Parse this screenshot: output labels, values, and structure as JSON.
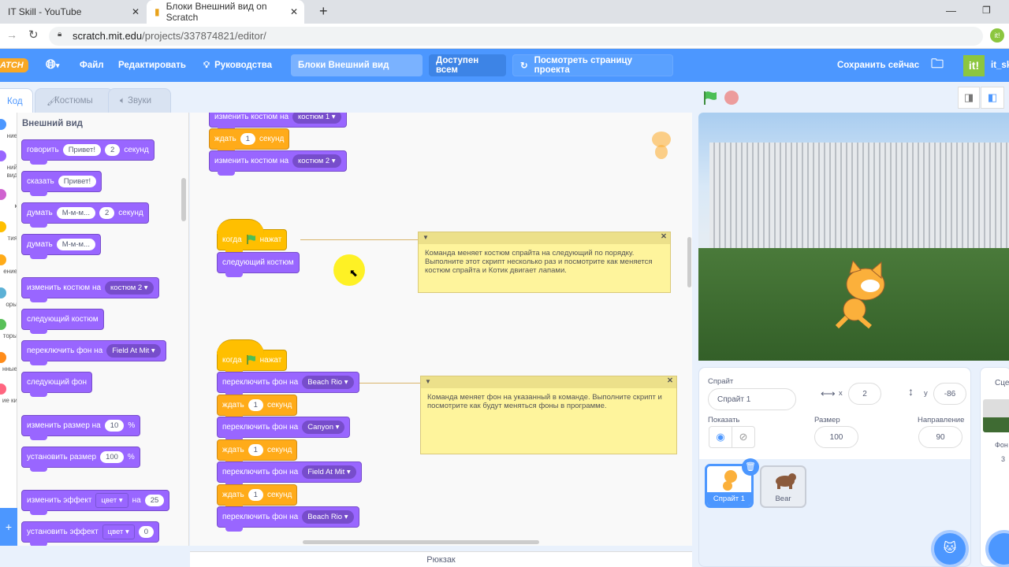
{
  "browser": {
    "tabs": [
      {
        "label": "IT Skill - YouTube"
      },
      {
        "label": "Блоки Внешний вид on Scratch"
      }
    ],
    "url_host": "scratch.mit.edu",
    "url_path": "/projects/337874821/editor/"
  },
  "menubar": {
    "logo": "SCRATCH",
    "file": "Файл",
    "edit": "Редактировать",
    "tutorials": "Руководства",
    "project_title": "Блоки Внешний вид",
    "share": "Доступен всем",
    "see_project": "Посмотреть страницу проекта",
    "save_now": "Сохранить сейчас",
    "username": "it_sk",
    "accent": "#4c97ff"
  },
  "editor_tabs": {
    "code": "Код",
    "costumes": "Костюмы",
    "sounds": "Звуки"
  },
  "categories": [
    {
      "label": "ние",
      "color": "#4c97ff"
    },
    {
      "label": "ний вид",
      "color": "#9966ff"
    },
    {
      "label": "к",
      "color": "#cf63cf"
    },
    {
      "label": "тия",
      "color": "#ffbf00"
    },
    {
      "label": "ение",
      "color": "#ffab19"
    },
    {
      "label": "оры",
      "color": "#5cb1d6"
    },
    {
      "label": "торы",
      "color": "#59c059"
    },
    {
      "label": "нные",
      "color": "#ff8c1a"
    },
    {
      "label": "ие ки",
      "color": "#ff6680"
    }
  ],
  "palette": {
    "heading": "Внешний вид",
    "blocks": [
      [
        {
          "t": "говорить"
        },
        {
          "in": "Привет!"
        },
        {
          "in": "2"
        },
        {
          "t": "секунд"
        }
      ],
      [
        {
          "t": "сказать"
        },
        {
          "in": "Привет!"
        }
      ],
      [
        {
          "t": "думать"
        },
        {
          "in": "М-м-м..."
        },
        {
          "in": "2"
        },
        {
          "t": "секунд"
        }
      ],
      [
        {
          "t": "думать"
        },
        {
          "in": "М-м-м..."
        }
      ],
      [
        {
          "t": "изменить костюм на"
        },
        {
          "dd": "костюм 2"
        }
      ],
      [
        {
          "t": "следующий костюм"
        }
      ],
      [
        {
          "t": "переключить фон на"
        },
        {
          "dd": "Field At Mit"
        }
      ],
      [
        {
          "t": "следующий фон"
        }
      ],
      [
        {
          "t": "изменить размер на"
        },
        {
          "in": "10"
        },
        {
          "t": "%"
        }
      ],
      [
        {
          "t": "установить размер"
        },
        {
          "in": "100"
        },
        {
          "t": "%"
        }
      ],
      [
        {
          "t": "изменить эффект"
        },
        {
          "sq": "цвет"
        },
        {
          "t": "на"
        },
        {
          "in": "25"
        }
      ],
      [
        {
          "t": "установить эффект"
        },
        {
          "sq": "цвет"
        },
        {
          "in": "0"
        }
      ]
    ]
  },
  "scripts": [
    [
      {
        "t": "изменить костюм на"
      },
      {
        "dd": "костюм 1"
      }
    ],
    [
      {
        "t": "ждать"
      },
      {
        "in": "1"
      },
      {
        "t": "секунд"
      }
    ],
    [
      {
        "t": "изменить костюм на"
      },
      {
        "dd": "костюм 2"
      }
    ],
    [
      {
        "t": "когда"
      },
      {
        "flag": true
      },
      {
        "t": "нажат"
      }
    ],
    [
      {
        "t": "следующий костюм"
      }
    ],
    [
      {
        "t": "когда"
      },
      {
        "flag": true
      },
      {
        "t": "нажат"
      }
    ],
    [
      {
        "t": "переключить фон на"
      },
      {
        "dd": "Beach Rio"
      }
    ],
    [
      {
        "t": "ждать"
      },
      {
        "in": "1"
      },
      {
        "t": "секунд"
      }
    ],
    [
      {
        "t": "переключить фон на"
      },
      {
        "dd": "Canyon"
      }
    ],
    [
      {
        "t": "ждать"
      },
      {
        "in": "1"
      },
      {
        "t": "секунд"
      }
    ],
    [
      {
        "t": "переключить фон на"
      },
      {
        "dd": "Field At Mit"
      }
    ],
    [
      {
        "t": "ждать"
      },
      {
        "in": "1"
      },
      {
        "t": "секунд"
      }
    ],
    [
      {
        "t": "переключить фон на"
      },
      {
        "dd": "Beach Rio"
      }
    ]
  ],
  "comments": [
    "Команда меняет костюм спрайта на следующий по порядку. Выполните этот скрипт несколько раз и посмотрите как меняется костюм спрайта и Котик двигает лапами.",
    "Команда меняет фон на указанный в команде. Выполните скрипт и посмотрите как будут меняться фоны в программе."
  ],
  "backpack": "Рюкзак",
  "sprite_info": {
    "sprite_label": "Спрайт",
    "sprite_name": "Спрайт 1",
    "x_label": "x",
    "x": "2",
    "y_label": "y",
    "y": "-86",
    "show_label": "Показать",
    "size_label": "Размер",
    "size": "100",
    "direction_label": "Направление",
    "direction": "90"
  },
  "sprites": [
    {
      "name": "Спрайт 1",
      "selected": true
    },
    {
      "name": "Bear",
      "selected": false
    }
  ],
  "stage_panel": {
    "title": "Сцен",
    "backdrops_label": "Фон",
    "backdrops_count": "3"
  }
}
